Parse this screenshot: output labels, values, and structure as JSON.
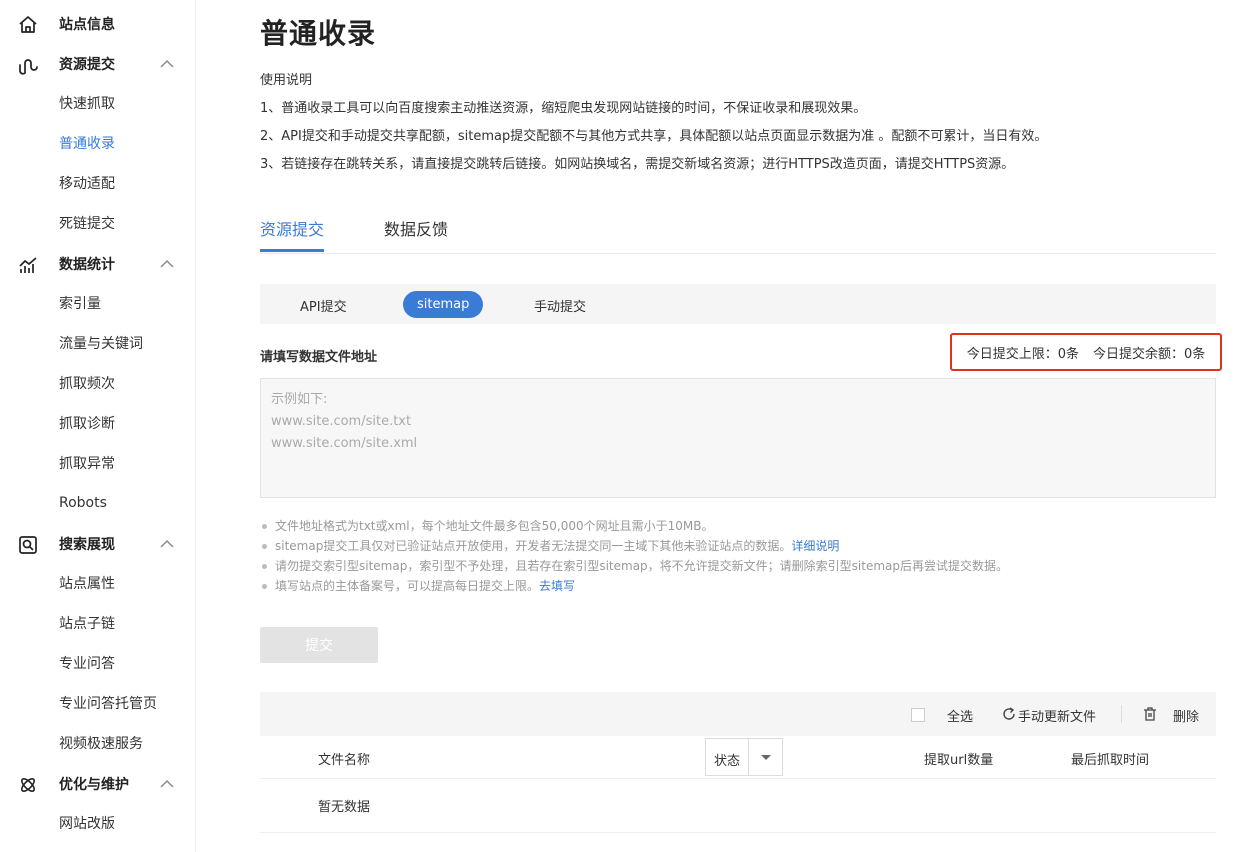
{
  "sidebar": {
    "sections": [
      {
        "label": "站点信息",
        "icon": "home-icon",
        "items": []
      },
      {
        "label": "资源提交",
        "icon": "resource-submit-icon",
        "items": [
          "快速抓取",
          "普通收录",
          "移动适配",
          "死链提交"
        ]
      },
      {
        "label": "数据统计",
        "icon": "stats-chart-icon",
        "items": [
          "索引量",
          "流量与关键词",
          "抓取频次",
          "抓取诊断",
          "抓取异常",
          "Robots"
        ]
      },
      {
        "label": "搜索展现",
        "icon": "search-display-icon",
        "items": [
          "站点属性",
          "站点子链",
          "专业问答",
          "专业问答托管页",
          "视频极速服务"
        ]
      },
      {
        "label": "优化与维护",
        "icon": "optimize-atom-icon",
        "items": [
          "网站改版"
        ]
      }
    ],
    "active_item": "普通收录"
  },
  "page": {
    "title": "普通收录",
    "usage_heading": "使用说明",
    "usage_lines": [
      "1、普通收录工具可以向百度搜索主动推送资源，缩短爬虫发现网站链接的时间，不保证收录和展现效果。",
      "2、API提交和手动提交共享配额，sitemap提交配额不与其他方式共享，具体配额以站点页面显示数据为准 。配额不可累计，当日有效。",
      "3、若链接存在跳转关系，请直接提交跳转后链接。如网站换域名，需提交新域名资源；进行HTTPS改造页面，请提交HTTPS资源。"
    ]
  },
  "tabs": {
    "items": [
      "资源提交",
      "数据反馈"
    ],
    "active": "资源提交"
  },
  "subtabs": {
    "items": [
      "API提交",
      "sitemap",
      "手动提交"
    ],
    "active": "sitemap"
  },
  "form": {
    "label": "请填写数据文件地址",
    "quota_limit": "今日提交上限：0条",
    "quota_remaining": "今日提交余额：0条",
    "placeholder_lines": [
      "示例如下:",
      "www.site.com/site.txt",
      "www.site.com/site.xml"
    ],
    "tips": [
      {
        "text": "文件地址格式为txt或xml，每个地址文件最多包含50,000个网址且需小于10MB。",
        "link": ""
      },
      {
        "text": "sitemap提交工具仅对已验证站点开放使用，开发者无法提交同一主域下其他未验证站点的数据。",
        "link": "详细说明"
      },
      {
        "text": "请勿提交索引型sitemap，索引型不予处理，且若存在索引型sitemap，将不允许提交新文件；请删除索引型sitemap后再尝试提交数据。",
        "link": ""
      },
      {
        "text": "填写站点的主体备案号，可以提高每日提交上限。",
        "link": "去填写"
      }
    ],
    "submit_label": "提交"
  },
  "table": {
    "toolbar": {
      "select_all": "全选",
      "refresh": "手动更新文件",
      "delete": "删除"
    },
    "columns": {
      "filename": "文件名称",
      "status": "状态",
      "url_count": "提取url数量",
      "last_crawl": "最后抓取时间"
    },
    "empty": "暂无数据"
  },
  "colors": {
    "accent": "#3a7bd5",
    "highlight_border": "#e0321f"
  }
}
